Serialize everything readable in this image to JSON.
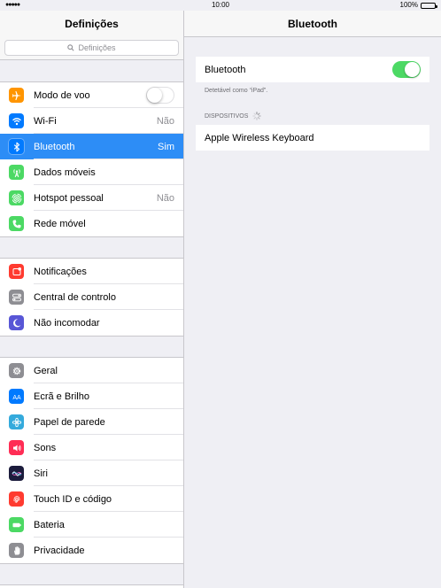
{
  "status_bar": {
    "signal": "●●●●●",
    "time": "10:00",
    "battery": "100%"
  },
  "left_pane": {
    "title": "Definições",
    "search_placeholder": "Definições",
    "groups": [
      [
        {
          "label": "Modo de voo",
          "icon": "airplane-icon",
          "color": "#ff9500",
          "toggle": "off"
        },
        {
          "label": "Wi-Fi",
          "icon": "wifi-icon",
          "color": "#007aff",
          "value": "Não"
        },
        {
          "label": "Bluetooth",
          "icon": "bluetooth-icon",
          "color": "#007aff",
          "value": "Sim",
          "selected": true
        },
        {
          "label": "Dados móveis",
          "icon": "antenna-icon",
          "color": "#4cd964"
        },
        {
          "label": "Hotspot pessoal",
          "icon": "hotspot-icon",
          "color": "#4cd964",
          "value": "Não"
        },
        {
          "label": "Rede móvel",
          "icon": "phone-icon",
          "color": "#4cd964"
        }
      ],
      [
        {
          "label": "Notificações",
          "icon": "notifications-icon",
          "color": "#ff3b30"
        },
        {
          "label": "Central de controlo",
          "icon": "control-center-icon",
          "color": "#8e8e93"
        },
        {
          "label": "Não incomodar",
          "icon": "moon-icon",
          "color": "#5856d6"
        }
      ],
      [
        {
          "label": "Geral",
          "icon": "gear-icon",
          "color": "#8e8e93"
        },
        {
          "label": "Ecrã e Brilho",
          "icon": "display-icon",
          "color": "#007aff"
        },
        {
          "label": "Papel de parede",
          "icon": "wallpaper-icon",
          "color": "#34aadc"
        },
        {
          "label": "Sons",
          "icon": "speaker-icon",
          "color": "#ff2d55"
        },
        {
          "label": "Siri",
          "icon": "siri-icon",
          "color": "#1c1c3c"
        },
        {
          "label": "Touch ID e código",
          "icon": "fingerprint-icon",
          "color": "#ff3b30"
        },
        {
          "label": "Bateria",
          "icon": "battery-icon",
          "color": "#4cd964"
        },
        {
          "label": "Privacidade",
          "icon": "hand-icon",
          "color": "#8e8e93"
        }
      ]
    ]
  },
  "right_pane": {
    "title": "Bluetooth",
    "bluetooth_label": "Bluetooth",
    "bluetooth_on": true,
    "discoverable_text": "Detetável como “iPad”.",
    "devices_header": "DISPOSITIVOS",
    "devices": [
      "Apple Wireless Keyboard"
    ],
    "colors": {
      "toggle_on": "#4cd964",
      "selected": "#2d8df6"
    }
  }
}
